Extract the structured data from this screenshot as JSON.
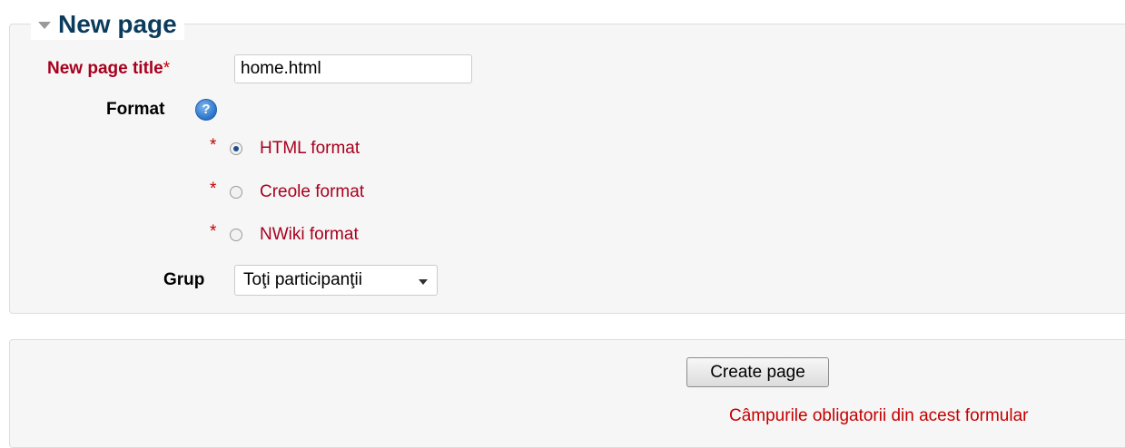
{
  "fieldset": {
    "legend": "New page"
  },
  "title_field": {
    "label": "New page title",
    "required_mark": "*",
    "value": "home.html"
  },
  "format": {
    "label": "Format",
    "help_icon": "help-icon",
    "options": [
      {
        "required_mark": "*",
        "label": "HTML format",
        "checked": true
      },
      {
        "required_mark": "*",
        "label": "Creole format",
        "checked": false
      },
      {
        "required_mark": "*",
        "label": "NWiki format",
        "checked": false
      }
    ]
  },
  "group": {
    "label": "Grup",
    "selected": "Toţi participanţii"
  },
  "actions": {
    "create_label": "Create page",
    "required_note": "Câmpurile obligatorii din acest formular"
  },
  "colors": {
    "required": "#a8001e",
    "legend": "#0b3c5d"
  }
}
